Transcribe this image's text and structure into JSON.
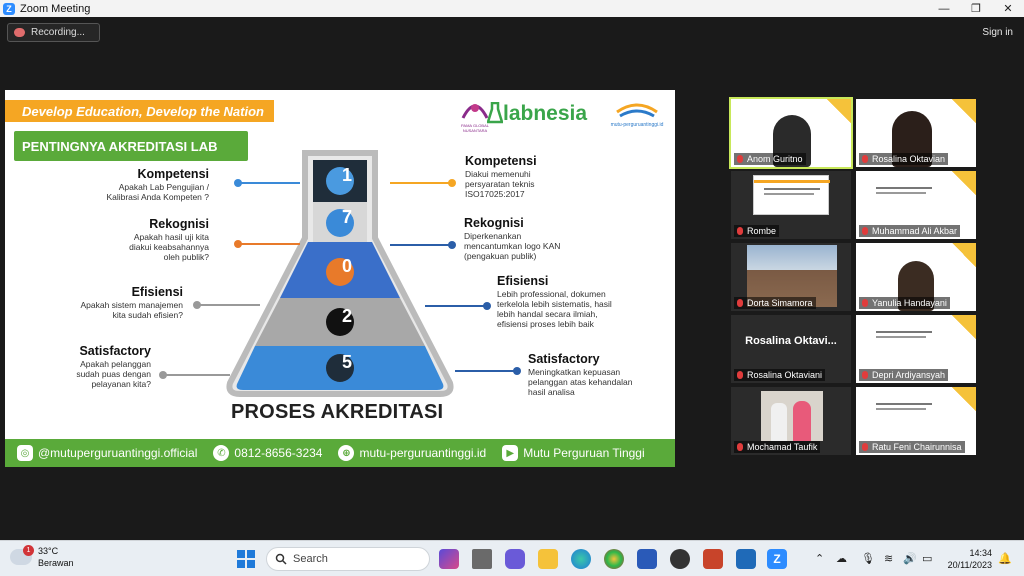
{
  "window": {
    "title": "Zoom Meeting",
    "minimize": "—",
    "maximize": "❐",
    "close": "✕"
  },
  "topbar": {
    "recording": "Recording...",
    "sign_in": "Sign in"
  },
  "slide": {
    "banner": "Develop Education, Develop the Nation",
    "heading": "PENTINGNYA AKREDITASI LAB",
    "logos": {
      "labnesia": "labnesia",
      "pama": "PAMA GLOBAL NUSANTARA",
      "mutu": "mutu-perguruantinggi.id"
    },
    "flask_numbers": [
      "1",
      "7",
      "0",
      "2",
      "5"
    ],
    "left": [
      {
        "title": "Kompetensi",
        "text": [
          "Apakah Lab Pengujian /",
          "Kalibrasi Anda Kompeten ?"
        ]
      },
      {
        "title": "Rekognisi",
        "text": [
          "Apakah hasil uji kita",
          "diakui keabsahannya",
          "oleh publik?"
        ]
      },
      {
        "title": "Efisiensi",
        "text": [
          "Apakah sistem manajemen",
          "kita sudah efisien?"
        ]
      },
      {
        "title": "Satisfactory",
        "text": [
          "Apakah pelanggan",
          "sudah puas dengan",
          "pelayanan kita?"
        ]
      }
    ],
    "right": [
      {
        "title": "Kompetensi",
        "text": [
          "Diakui memenuhi",
          "persyaratan teknis",
          "ISO17025:2017"
        ]
      },
      {
        "title": "Rekognisi",
        "text": [
          "Diperkenankan",
          "mencantumkan logo KAN",
          "(pengakuan publik)"
        ]
      },
      {
        "title": "Efisiensi",
        "text": [
          "Lebih professional, dokumen",
          "terkelola lebih sistematis, hasil",
          "lebih handal secara ilmiah,",
          "efisiensi proses lebih baik"
        ]
      },
      {
        "title": "Satisfactory",
        "text": [
          "Meningkatkan kepuasan",
          "pelanggan atas kehandalan",
          "hasil analisa"
        ]
      }
    ],
    "proses": "PROSES AKREDITASI",
    "footer": [
      "@mutuperguruantinggi.official",
      "0812-8656-3234",
      "mutu-perguruantinggi.id",
      "Mutu Perguruan Tinggi"
    ],
    "colors": {
      "orange": "#f5a623",
      "green": "#5aaa3a",
      "blue": "#3a8ad8",
      "dark": "#1f2d3a"
    }
  },
  "participants": [
    {
      "name": "Anom Guritno",
      "type": "camera"
    },
    {
      "name": "Rosalina Oktavian",
      "type": "camera"
    },
    {
      "name": "Rombe",
      "type": "slide"
    },
    {
      "name": "Muhammad Ali Akbar",
      "type": "slide"
    },
    {
      "name": "Dorta Simamora",
      "type": "building"
    },
    {
      "name": "Yanulia Handayani",
      "type": "camera"
    },
    {
      "name": "Rosalina Oktaviani",
      "type": "text",
      "display": "Rosalina  Oktavi..."
    },
    {
      "name": "Depri Ardiyansyah",
      "type": "slide"
    },
    {
      "name": "Mochamad Taufik",
      "type": "photo"
    },
    {
      "name": "Ratu Feni Chairunnisa",
      "type": "slide"
    }
  ],
  "taskbar": {
    "weather_temp": "33°C",
    "weather_desc": "Berawan",
    "weather_badge": "1",
    "search_placeholder": "Search",
    "time": "14:34",
    "date": "20/11/2023"
  }
}
